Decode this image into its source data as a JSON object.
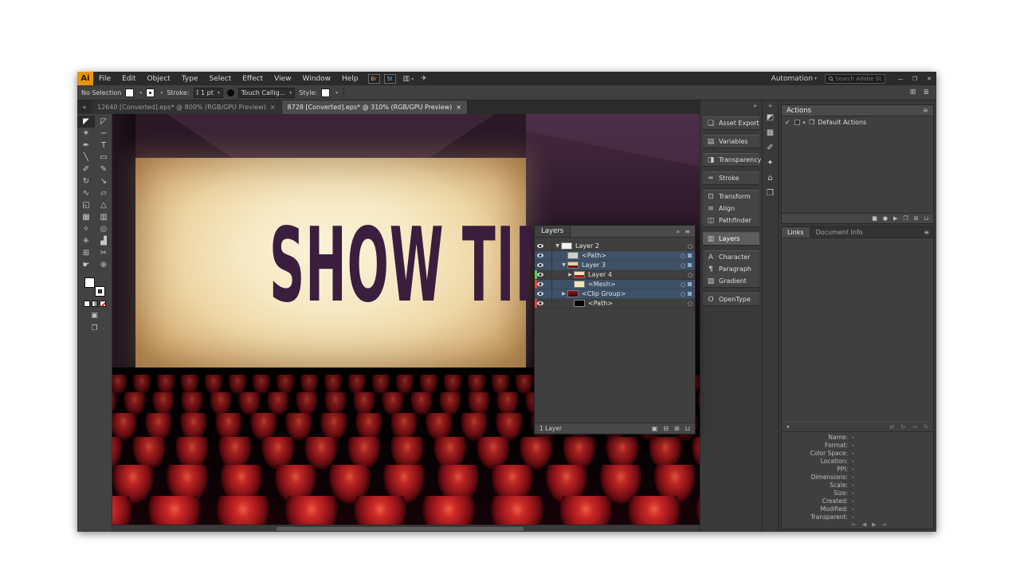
{
  "menubar": {
    "logo": "Ai",
    "menus": [
      "File",
      "Edit",
      "Object",
      "Type",
      "Select",
      "Effect",
      "View",
      "Window",
      "Help"
    ],
    "bridge_label": "Br",
    "stock_label": "St",
    "layout_icon": "▥",
    "share_icon": "✈",
    "automation_label": "Automation",
    "search_placeholder": "Search Adobe Stock",
    "window_controls": {
      "minimize": "—",
      "restore": "❐",
      "close": "✕"
    }
  },
  "controlbar": {
    "selection_status": "No Selection",
    "stroke_label": "Stroke:",
    "stroke_value": "1 pt",
    "brush_name": "Touch Callig...",
    "style_label": "Style:",
    "right_icons": [
      "⊞",
      "≣"
    ]
  },
  "tabs": [
    {
      "title": "12640 [Converted].eps* @ 800% (RGB/GPU Preview)",
      "close": "×"
    },
    {
      "title": "8728 [Converted].eps* @ 310% (RGB/GPU Preview)",
      "close": "×"
    }
  ],
  "toolbar": {
    "collapse": "«",
    "tools": [
      {
        "name": "selection",
        "glyph": "◤"
      },
      {
        "name": "direct-selection",
        "glyph": "◸"
      },
      {
        "name": "magic-wand",
        "glyph": "✶"
      },
      {
        "name": "lasso",
        "glyph": "∽"
      },
      {
        "name": "pen",
        "glyph": "✒"
      },
      {
        "name": "type",
        "glyph": "T"
      },
      {
        "name": "line-segment",
        "glyph": "╲"
      },
      {
        "name": "rectangle",
        "glyph": "▭"
      },
      {
        "name": "paintbrush",
        "glyph": "✐"
      },
      {
        "name": "pencil",
        "glyph": "✎"
      },
      {
        "name": "rotate",
        "glyph": "↻"
      },
      {
        "name": "scale",
        "glyph": "↘"
      },
      {
        "name": "width",
        "glyph": "∿"
      },
      {
        "name": "free-transform",
        "glyph": "▱"
      },
      {
        "name": "shape-builder",
        "glyph": "◱"
      },
      {
        "name": "perspective-grid",
        "glyph": "△"
      },
      {
        "name": "mesh",
        "glyph": "▦"
      },
      {
        "name": "gradient",
        "glyph": "▥"
      },
      {
        "name": "eyedropper",
        "glyph": "✧"
      },
      {
        "name": "blend",
        "glyph": "◎"
      },
      {
        "name": "symbol-sprayer",
        "glyph": "✳"
      },
      {
        "name": "column-graph",
        "glyph": "▟"
      },
      {
        "name": "artboard",
        "glyph": "⊞"
      },
      {
        "name": "slice",
        "glyph": "✂"
      },
      {
        "name": "hand",
        "glyph": "☛"
      },
      {
        "name": "zoom",
        "glyph": "⊕"
      }
    ]
  },
  "canvas": {
    "screen_text": "SHOW TIM"
  },
  "layers_panel": {
    "title": "Layers",
    "collapse": "»",
    "panel_menu": "≡",
    "target_icon": "○",
    "rows": [
      {
        "name": "Layer 2",
        "disclosure": "▼"
      },
      {
        "name": "<Path>",
        "disclosure": ""
      },
      {
        "name": "Layer 3",
        "disclosure": "▼"
      },
      {
        "name": "Layer 4",
        "disclosure": "▶"
      },
      {
        "name": "<Mesh>",
        "disclosure": ""
      },
      {
        "name": "<Clip Group>",
        "disclosure": "▶"
      },
      {
        "name": "<Path>",
        "disclosure": ""
      }
    ],
    "status": "1 Layer",
    "footer_icons": [
      "▣",
      "⊟",
      "⊞",
      "⊔"
    ]
  },
  "dock": {
    "collapse": "»",
    "mini_collapse": "«",
    "panels": [
      {
        "label": "Asset Export",
        "glyph": "❏"
      },
      {
        "label": "Variables",
        "glyph": "▤"
      },
      {
        "label": "Transparency",
        "glyph": "◨"
      },
      {
        "label": "Stroke",
        "glyph": "═"
      },
      {
        "label": "Transform",
        "glyph": "⊡"
      },
      {
        "label": "Align",
        "glyph": "≡"
      },
      {
        "label": "Pathfinder",
        "glyph": "◫"
      },
      {
        "label": "Layers",
        "glyph": "▥"
      },
      {
        "label": "Character",
        "glyph": "A"
      },
      {
        "label": "Paragraph",
        "glyph": "¶"
      },
      {
        "label": "Gradient",
        "glyph": "▨"
      },
      {
        "label": "OpenType",
        "glyph": "O"
      }
    ],
    "mini_icons": [
      "◩",
      "▦",
      "✐",
      "✦",
      "⌂",
      "❒"
    ]
  },
  "actions_panel": {
    "title": "Actions",
    "menu": "≡",
    "check": "✓",
    "expander": "▸",
    "folder_icon": "❒",
    "item": "Default Actions",
    "footer_icons": [
      "■",
      "●",
      "▶",
      "❒",
      "⊞",
      "⊔"
    ]
  },
  "links_panel": {
    "tabs": [
      "Links",
      "Document Info"
    ],
    "menu": "≡",
    "expander": "▾",
    "tool_icons": [
      "⇄",
      "↻",
      "→",
      "✎"
    ],
    "fields": [
      {
        "label": "Name:",
        "value": "-"
      },
      {
        "label": "Format:",
        "value": "-"
      },
      {
        "label": "Color Space:",
        "value": "-"
      },
      {
        "label": "Location:",
        "value": "-"
      },
      {
        "label": "PPI:",
        "value": "-"
      },
      {
        "label": "Dimensions:",
        "value": "-"
      },
      {
        "label": "Scale:",
        "value": "-"
      },
      {
        "label": "Size:",
        "value": "-"
      },
      {
        "label": "Created:",
        "value": "-"
      },
      {
        "label": "Modified:",
        "value": "-"
      },
      {
        "label": "Transparent:",
        "value": "-"
      }
    ],
    "nav_icons": [
      "⇤",
      "◀",
      "▶",
      "⇥"
    ]
  },
  "colors": {
    "selection_highlight": "#3e5166",
    "layer_color_green": "#49d24f",
    "layer_color_red": "#e24040",
    "screen_glow": "#f6e8c2",
    "screen_text": "#3b1e3e",
    "seat_red": "#a1181d",
    "logo_orange": "#e8930c"
  }
}
